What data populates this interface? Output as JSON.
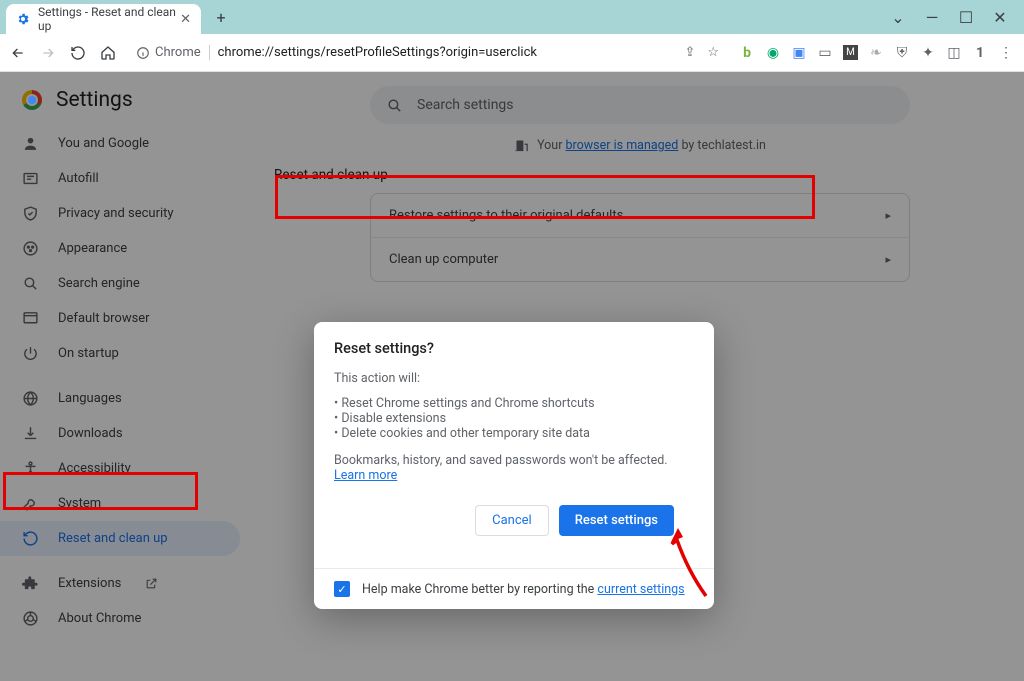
{
  "window": {
    "tab_title": "Settings - Reset and clean up"
  },
  "toolbar": {
    "chrome_label": "Chrome",
    "url": "chrome://settings/resetProfileSettings?origin=userclick"
  },
  "settings": {
    "title": "Settings",
    "nav": [
      {
        "label": "You and Google",
        "icon": "person"
      },
      {
        "label": "Autofill",
        "icon": "autofill"
      },
      {
        "label": "Privacy and security",
        "icon": "shield"
      },
      {
        "label": "Appearance",
        "icon": "paint"
      },
      {
        "label": "Search engine",
        "icon": "search"
      },
      {
        "label": "Default browser",
        "icon": "browser"
      },
      {
        "label": "On startup",
        "icon": "power"
      }
    ],
    "nav2": [
      {
        "label": "Languages",
        "icon": "globe"
      },
      {
        "label": "Downloads",
        "icon": "download"
      },
      {
        "label": "Accessibility",
        "icon": "a11y"
      },
      {
        "label": "System",
        "icon": "wrench"
      },
      {
        "label": "Reset and clean up",
        "icon": "restore",
        "active": true
      }
    ],
    "nav3": [
      {
        "label": "Extensions",
        "icon": "extension",
        "external": true
      },
      {
        "label": "About Chrome",
        "icon": "chrome"
      }
    ]
  },
  "main": {
    "search_placeholder": "Search settings",
    "managed_prefix": "Your ",
    "managed_link": "browser is managed",
    "managed_suffix": " by techlatest.in",
    "section_title": "Reset and clean up",
    "row_restore": "Restore settings to their original defaults",
    "row_cleanup": "Clean up computer"
  },
  "dialog": {
    "title": "Reset settings?",
    "subtitle": "This action will:",
    "bullets": [
      "Reset Chrome settings and Chrome shortcuts",
      "Disable extensions",
      "Delete cookies and other temporary site data"
    ],
    "note_prefix": "Bookmarks, history, and saved passwords won't be affected. ",
    "note_link": "Learn more",
    "cancel": "Cancel",
    "confirm": "Reset settings",
    "footer_prefix": "Help make Chrome better by reporting the ",
    "footer_link": "current settings"
  }
}
